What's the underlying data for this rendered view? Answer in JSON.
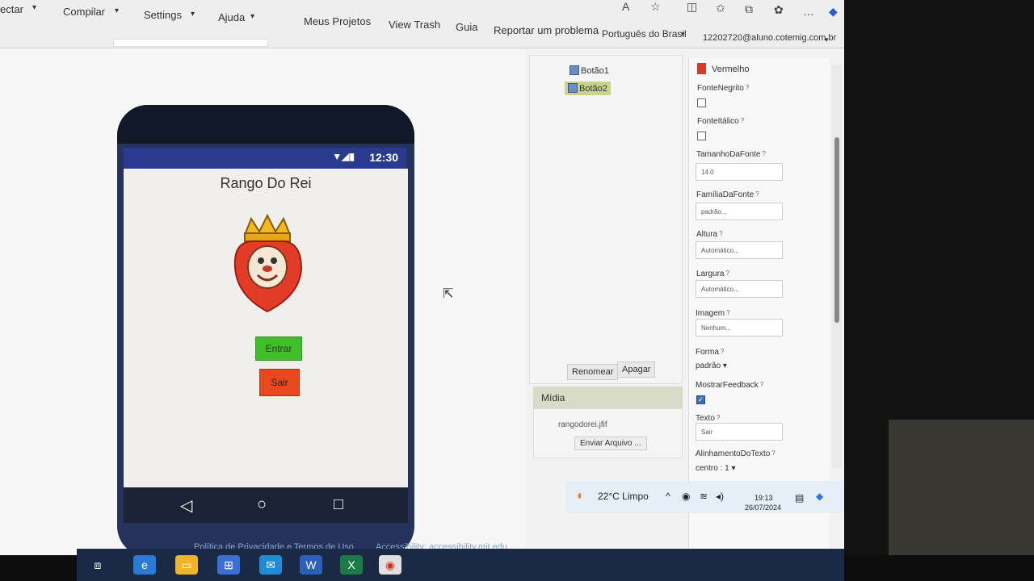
{
  "menu": {
    "conectar": "ectar",
    "compilar": "Compilar",
    "settings": "Settings",
    "ajuda": "Ajuda",
    "meus_projetos": "Meus Projetos",
    "view_trash": "View Trash",
    "guia": "Guia",
    "reportar": "Reportar um problema",
    "idioma": "Português do Brasil",
    "usuario": "12202720@aluno.cotemig.com.br"
  },
  "phone": {
    "time": "12:30",
    "app_title": "Rango Do Rei",
    "btn_entrar": "Entrar",
    "btn_sair": "Sair"
  },
  "footer": {
    "privacy": "Política de Privacidade e Termos de Uso",
    "accessibility": "Accessibility: accessibility.mit.edu"
  },
  "components": {
    "items": [
      "Botão1",
      "Botão2"
    ],
    "rename": "Renomear",
    "delete": "Apagar"
  },
  "media": {
    "header": "Mídia",
    "file": "rangodorei.jfif",
    "upload": "Enviar Arquivo ..."
  },
  "properties": {
    "color_value": "Vermelho",
    "fonte_negrito": "FonteNegrito",
    "fonte_italico": "FonteItálico",
    "tamanho_fonte": "TamanhoDaFonte",
    "tamanho_fonte_value": "14.0",
    "familia_fonte": "FamíliaDaFonte",
    "familia_fonte_value": "padrão...",
    "altura": "Altura",
    "altura_value": "Automático...",
    "largura": "Largura",
    "largura_value": "Automático...",
    "imagem": "Imagem",
    "imagem_value": "Nenhum...",
    "forma": "Forma",
    "forma_value": "padrão",
    "mostrar_feedback": "MostrarFeedback",
    "texto": "Texto",
    "texto_value": "Sair",
    "alinhamento": "AlinhamentoDoTexto",
    "alinhamento_value": "centro : 1"
  },
  "tray": {
    "weather": "22°C  Limpo",
    "time": "19:13",
    "date": "26/07/2024"
  },
  "colors": {
    "statusbar": "#2a3b8f",
    "entrar": "#3fbf2a",
    "sair": "#e9481e",
    "selected": "#c8d48a",
    "swatch": "#d83a2a"
  }
}
